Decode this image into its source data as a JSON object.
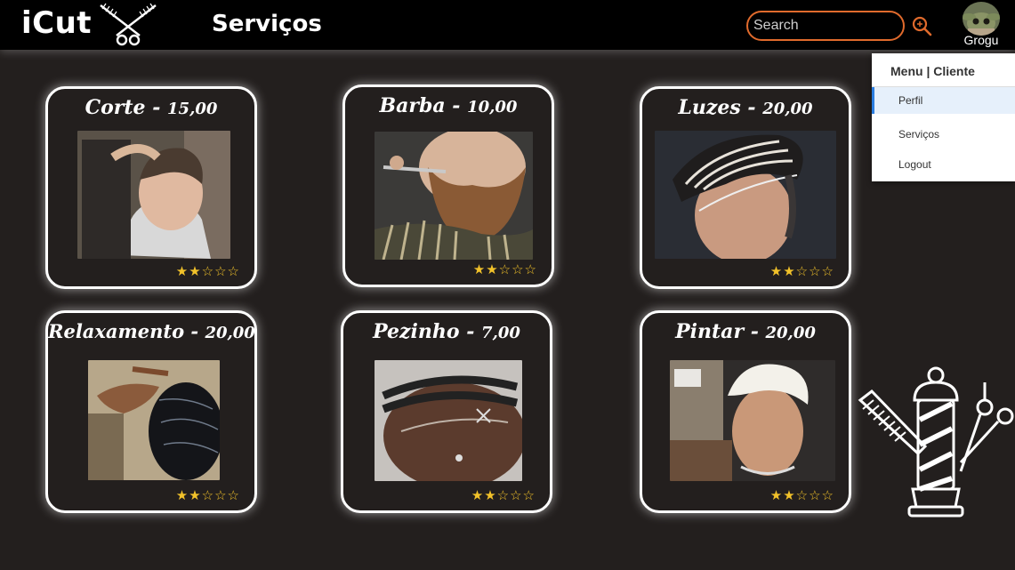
{
  "header": {
    "brand": "iCut",
    "brand_icon": "scissors-comb-icon",
    "title": "Serviços",
    "search": {
      "placeholder": "Search",
      "value": ""
    },
    "search_icon": "search-icon",
    "user": {
      "name": "Grogu",
      "avatar_icon": "avatar"
    }
  },
  "menu": {
    "header": "Menu | Cliente",
    "items": [
      {
        "label": "Perfil",
        "active": true
      },
      {
        "label": "Serviços",
        "active": false
      },
      {
        "label": "Logout",
        "active": false
      }
    ]
  },
  "services": [
    {
      "name": "Corte",
      "price": "15,00",
      "rating": 2,
      "max_rating": 5
    },
    {
      "name": "Barba",
      "price": "10,00",
      "rating": 2,
      "max_rating": 5
    },
    {
      "name": "Luzes",
      "price": "20,00",
      "rating": 2,
      "max_rating": 5
    },
    {
      "name": "Relaxamento",
      "price": "20,00",
      "rating": 2,
      "max_rating": 5
    },
    {
      "name": "Pezinho",
      "price": "7,00",
      "rating": 2,
      "max_rating": 5
    },
    {
      "name": "Pintar",
      "price": "20,00",
      "rating": 2,
      "max_rating": 5
    }
  ],
  "colors": {
    "background": "#231f1e",
    "header": "#000000",
    "accent": "#e06a2c",
    "star": "#f2c22a"
  }
}
